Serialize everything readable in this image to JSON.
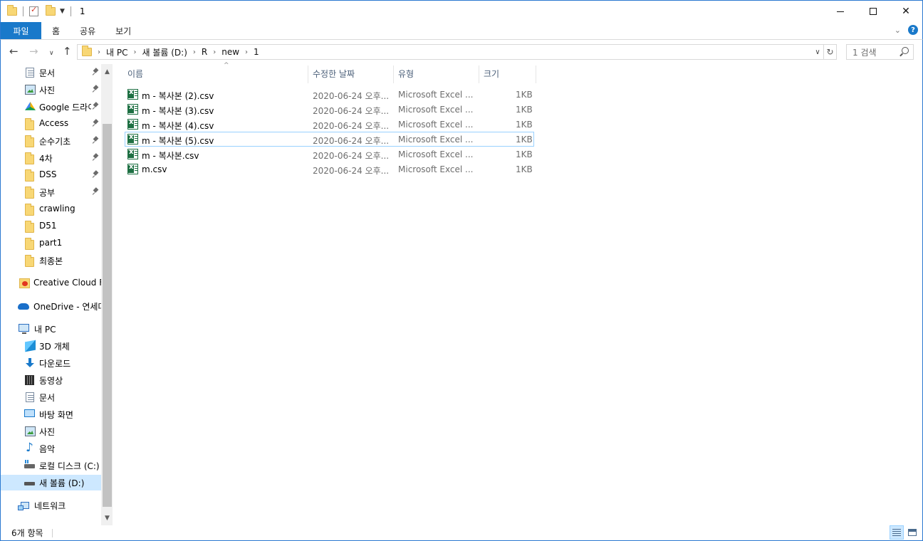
{
  "window": {
    "title": "1"
  },
  "ribbon": {
    "tabs": [
      "파일",
      "홈",
      "공유",
      "보기"
    ]
  },
  "address": {
    "crumbs": [
      "내 PC",
      "새 볼륨 (D:)",
      "R",
      "new",
      "1"
    ],
    "search_placeholder": "1 검색"
  },
  "nav": {
    "quick_access": [
      {
        "label": "문서",
        "icon": "document-icon",
        "pinned": true
      },
      {
        "label": "사진",
        "icon": "pictures-icon",
        "pinned": true
      },
      {
        "label": "Google 드라이브",
        "icon": "google-drive-icon",
        "pinned": true
      },
      {
        "label": "Access",
        "icon": "folder-icon",
        "pinned": true
      },
      {
        "label": "순수기초",
        "icon": "folder-icon",
        "pinned": true
      },
      {
        "label": "4차",
        "icon": "folder-icon",
        "pinned": true
      },
      {
        "label": "DSS",
        "icon": "folder-icon",
        "pinned": true
      },
      {
        "label": "공부",
        "icon": "folder-icon",
        "pinned": true
      },
      {
        "label": "crawling",
        "icon": "folder-icon",
        "pinned": false
      },
      {
        "label": "D51",
        "icon": "folder-icon",
        "pinned": false
      },
      {
        "label": "part1",
        "icon": "folder-icon",
        "pinned": false
      },
      {
        "label": "최종본",
        "icon": "folder-icon",
        "pinned": false
      }
    ],
    "creative_cloud": "Creative Cloud Files",
    "onedrive": "OneDrive - 연세대학교",
    "this_pc": "내 PC",
    "pc_items": [
      {
        "label": "3D 개체",
        "icon": "3d-objects-icon"
      },
      {
        "label": "다운로드",
        "icon": "downloads-icon"
      },
      {
        "label": "동영상",
        "icon": "videos-icon"
      },
      {
        "label": "문서",
        "icon": "document-icon"
      },
      {
        "label": "바탕 화면",
        "icon": "desktop-icon"
      },
      {
        "label": "사진",
        "icon": "pictures-icon"
      },
      {
        "label": "음악",
        "icon": "music-icon"
      },
      {
        "label": "로컬 디스크 (C:)",
        "icon": "local-disk-icon"
      },
      {
        "label": "새 볼륨 (D:)",
        "icon": "drive-icon",
        "selected": true
      }
    ],
    "network": "네트워크"
  },
  "columns": {
    "name": "이름",
    "modified": "수정한 날짜",
    "type": "유형",
    "size": "크기"
  },
  "files": [
    {
      "name": "m - 복사본 (2).csv",
      "modified": "2020-06-24 오후...",
      "type": "Microsoft Excel ...",
      "size": "1KB"
    },
    {
      "name": "m - 복사본 (3).csv",
      "modified": "2020-06-24 오후...",
      "type": "Microsoft Excel ...",
      "size": "1KB"
    },
    {
      "name": "m - 복사본 (4).csv",
      "modified": "2020-06-24 오후...",
      "type": "Microsoft Excel ...",
      "size": "1KB"
    },
    {
      "name": "m - 복사본 (5).csv",
      "modified": "2020-06-24 오후...",
      "type": "Microsoft Excel ...",
      "size": "1KB",
      "focused": true
    },
    {
      "name": "m - 복사본.csv",
      "modified": "2020-06-24 오후...",
      "type": "Microsoft Excel ...",
      "size": "1KB"
    },
    {
      "name": "m.csv",
      "modified": "2020-06-24 오후...",
      "type": "Microsoft Excel ...",
      "size": "1KB"
    }
  ],
  "status": {
    "item_count": "6개 항목"
  },
  "colors": {
    "accent": "#1979ca",
    "selection": "#cde8ff",
    "focus_border": "#99d1ff",
    "excel_green": "#1d6f42"
  }
}
